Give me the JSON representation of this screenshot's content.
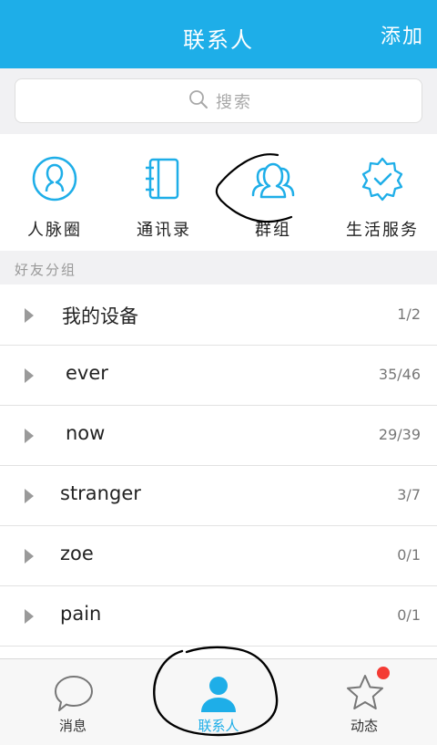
{
  "header": {
    "title": "联系人",
    "add_label": "添加"
  },
  "search": {
    "placeholder": "搜索"
  },
  "quick_entries": [
    {
      "label": "人脉圈",
      "icon": "person-circle-icon"
    },
    {
      "label": "通讯录",
      "icon": "address-book-icon"
    },
    {
      "label": "群组",
      "icon": "group-icon"
    },
    {
      "label": "生活服务",
      "icon": "badge-check-icon"
    }
  ],
  "section_title": "好友分组",
  "groups": [
    {
      "name": "我的设备",
      "count": "1/2"
    },
    {
      "name": "ever",
      "count": "35/46"
    },
    {
      "name": "now",
      "count": "29/39"
    },
    {
      "name": "stranger",
      "count": "3/7"
    },
    {
      "name": "zoe",
      "count": "0/1"
    },
    {
      "name": "pain",
      "count": "0/1"
    }
  ],
  "tabs": [
    {
      "label": "消息",
      "icon": "chat-bubble-icon"
    },
    {
      "label": "联系人",
      "icon": "contacts-person-icon"
    },
    {
      "label": "动态",
      "icon": "star-icon"
    }
  ],
  "colors": {
    "accent": "#1eaee8",
    "badge": "#f43b34",
    "section_bg": "#f1f1f3"
  }
}
